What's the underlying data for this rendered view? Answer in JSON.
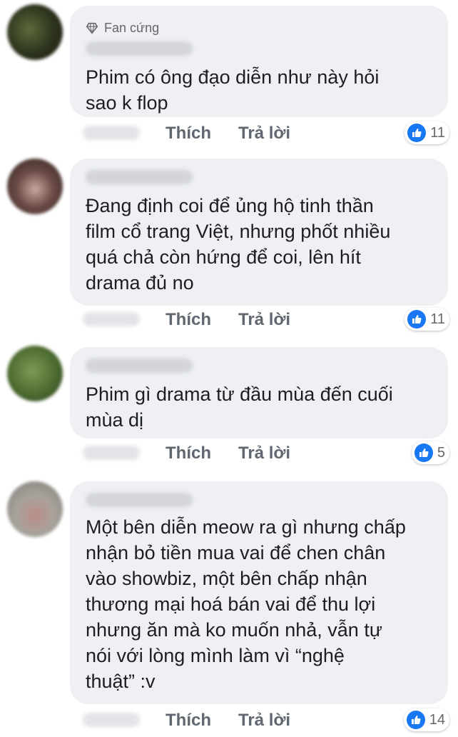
{
  "actions": {
    "like_label": "Thích",
    "reply_label": "Trả lời"
  },
  "comments": [
    {
      "badge": "Fan cứng",
      "text_lines": [
        "Phim có ông đạo diễn như này hỏi",
        "sao k flop"
      ],
      "reaction_icon": "like-icon",
      "reaction_count": "11",
      "avatar_color": "#3d4a2a"
    },
    {
      "text_lines": [
        "Đang định coi để ủng hộ tinh thần",
        "film cổ trang Việt, nhưng phốt nhiều",
        "quá chả còn hứng để coi, lên hít",
        "drama đủ no"
      ],
      "reaction_icon": "like-icon",
      "reaction_count": "11",
      "avatar_color": "#5a3f3a"
    },
    {
      "text_lines": [
        "Phim gì drama từ đầu mùa đến cuối",
        "mùa dị"
      ],
      "reaction_icon": "like-icon",
      "reaction_count": "5",
      "avatar_color": "#4e6a35"
    },
    {
      "text_lines": [
        "Một bên diễn meow ra gì nhưng chấp",
        "nhận bỏ tiền mua vai để chen chân",
        "vào showbiz, một bên chấp nhận",
        "thương mại hoá bán vai để thu lợi",
        "nhưng ăn mà ko muốn nhả, vẫn tự",
        "nói với lòng mình làm vì “nghệ",
        "thuật” :v"
      ],
      "reaction_icon": "like-icon",
      "reaction_count": "14",
      "avatar_color": "#9a8f8a"
    }
  ],
  "colors": {
    "bubble": "#eef0f3",
    "accent": "#1877f2",
    "muted": "#606770"
  }
}
